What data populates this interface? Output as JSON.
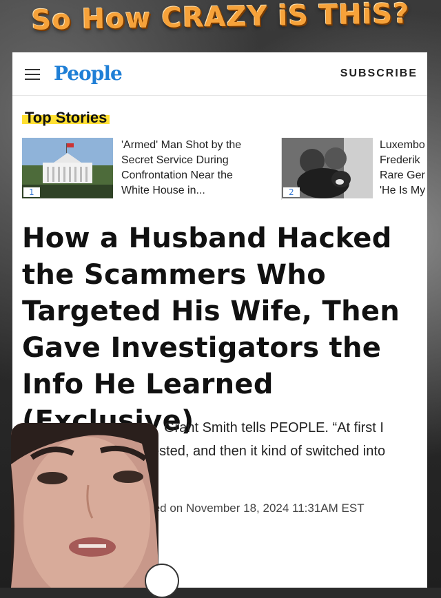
{
  "overlay": {
    "title": "So How CRAZY iS THiS?"
  },
  "header": {
    "logo": "People",
    "subscribe": "SUBSCRIBE"
  },
  "top_stories": {
    "label": "Top Stories",
    "items": [
      {
        "number": "1",
        "title": "'Armed' Man Shot by the Secret Service During Confrontation Near the White House in..."
      },
      {
        "number": "2",
        "title": "Luxembo Frederik Rare Ger 'He Is My"
      }
    ]
  },
  "article": {
    "headline": "How a Husband Hacked the Scammers Who Targeted His Wife, Then Gave Investigators the Info He Learned (Exclusive)",
    "dek_line1": "Grant Smith tells PEOPLE. “At first I",
    "dek_line2": "ested, and then it kind of switched into",
    "published": "ted on November 18, 2024 11:31AM EST"
  },
  "icons": [
    "menu-icon",
    "share-icon"
  ]
}
